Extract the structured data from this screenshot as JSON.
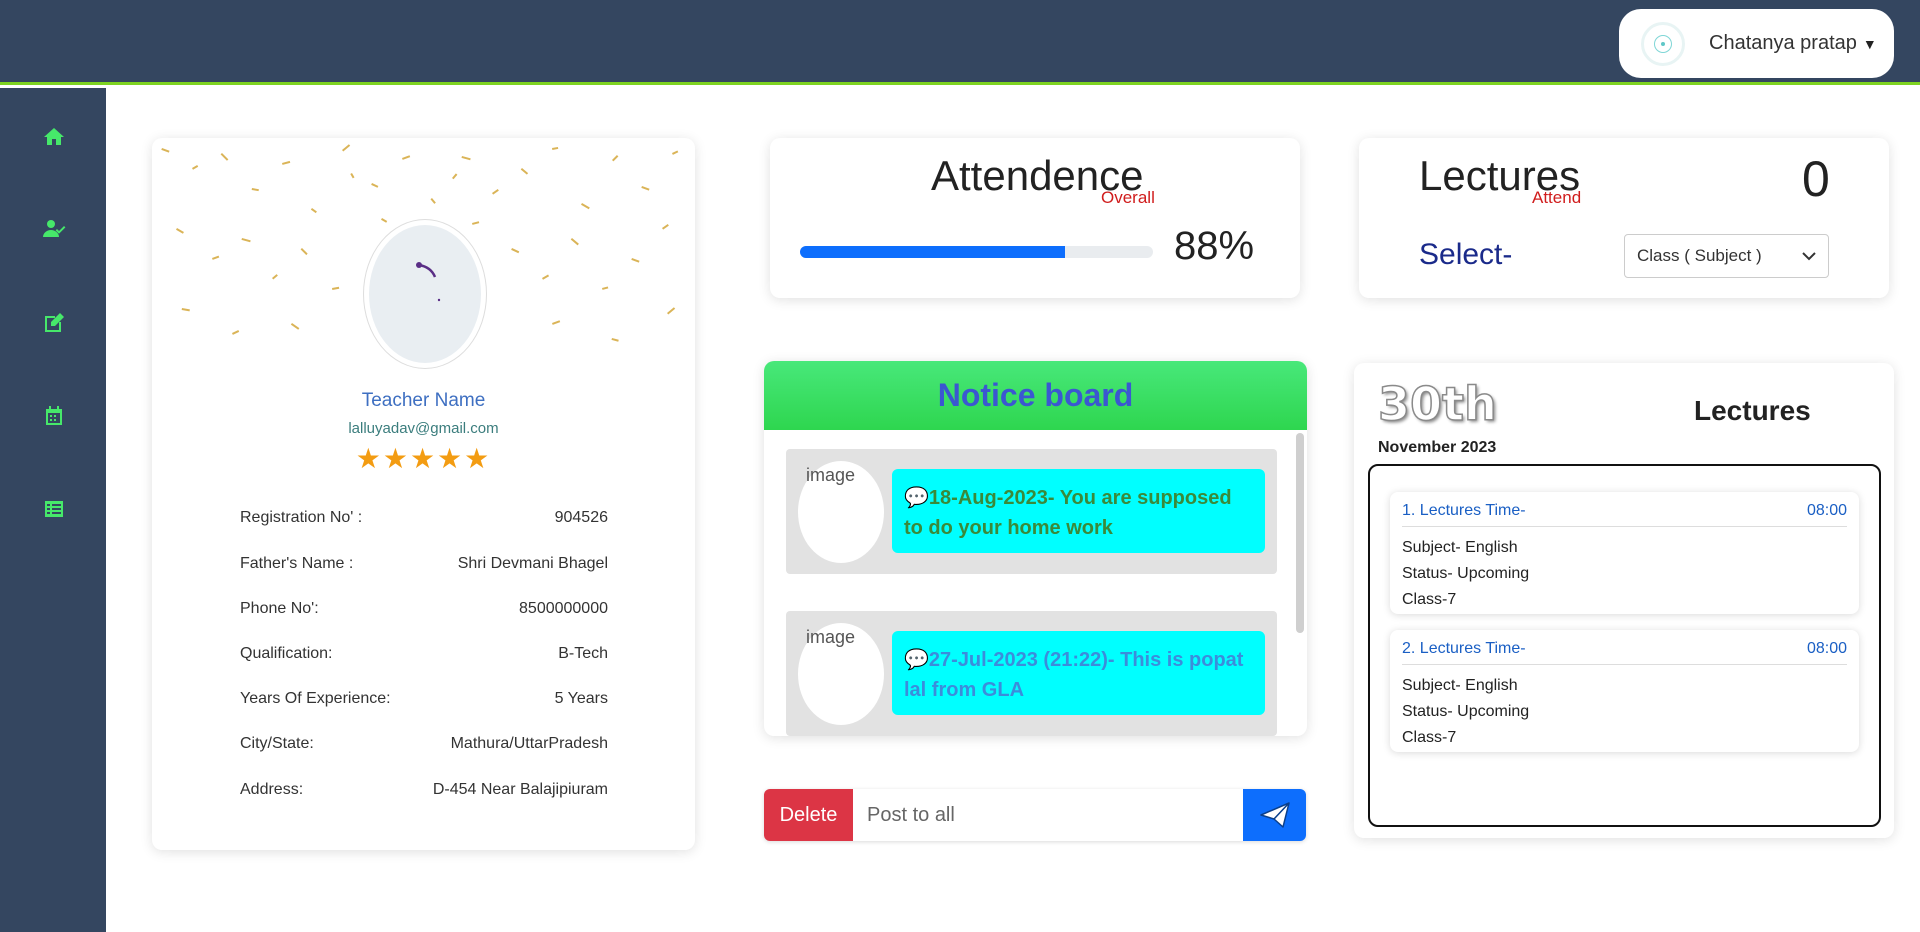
{
  "header": {
    "user_name": "Chatanya pratap"
  },
  "sidebar": {
    "items": [
      "home-icon",
      "user-check-icon",
      "edit-icon",
      "calendar-icon",
      "list-icon"
    ]
  },
  "profile": {
    "name": "Teacher Name",
    "email": "lalluyadav@gmail.com",
    "stars": "★★★★★",
    "rating": 5,
    "rows": [
      {
        "label": "Registration No' :",
        "value": "904526"
      },
      {
        "label": "Father's Name :",
        "value": "Shri Devmani Bhagel"
      },
      {
        "label": "Phone No':",
        "value": "8500000000"
      },
      {
        "label": "Qualification:",
        "value": "B-Tech"
      },
      {
        "label": "Years Of Experience:",
        "value": "5 Years"
      },
      {
        "label": "City/State:",
        "value": "Mathura/UttarPradesh"
      },
      {
        "label": "Address:",
        "value": "D-454 Near Balajipiuram"
      }
    ]
  },
  "attendance": {
    "title": "Attendence",
    "subtitle": "Overall",
    "percent_label": "88%",
    "fill_fraction": 0.75
  },
  "lectures_attend": {
    "title": "Lectures",
    "subtitle": "Attend",
    "count": "0",
    "select_label": "Select-",
    "select_value": "Class ( Subject )"
  },
  "notice": {
    "title": "Notice board",
    "image_alt": "image",
    "items": [
      {
        "text": "18-Aug-2023- You are supposed to do your home work",
        "color": "#3a8a3a"
      },
      {
        "text": "27-Jul-2023 (21:22)- This is popat lal from GLA",
        "color": "#3b8ddb"
      }
    ]
  },
  "post": {
    "delete_label": "Delete",
    "placeholder": "Post to all"
  },
  "schedule": {
    "day": "30th",
    "title": "Lectures",
    "month": "November 2023",
    "lectures": [
      {
        "head": "1. Lectures Time-",
        "time": "08:00",
        "subject": "Subject- English",
        "status": "Status- Upcoming",
        "class": "Class-7"
      },
      {
        "head": "2. Lectures Time-",
        "time": "08:00",
        "subject": "Subject- English",
        "status": "Status- Upcoming",
        "class": "Class-7"
      }
    ]
  },
  "colors": {
    "nav": "#344660",
    "accent_green": "#46e86a",
    "progress": "#0d6efd",
    "danger": "#dc3545",
    "bubble": "#00ffff"
  }
}
